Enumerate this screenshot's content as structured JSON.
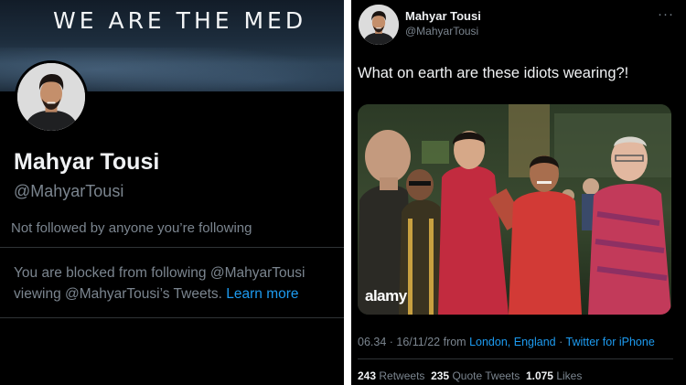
{
  "profile": {
    "banner_text": "WE ARE THE MED",
    "name": "Mahyar Tousi",
    "handle": "@MahyarTousi",
    "follow_context": "Not followed by anyone you’re following",
    "blocked_text": "You are blocked from following @MahyarTousi viewing @MahyarTousi’s Tweets.",
    "learn_more": "Learn more"
  },
  "tweet": {
    "author_name": "Mahyar Tousi",
    "author_handle": "@MahyarTousi",
    "more_label": "···",
    "text": "What on earth are these idiots wearing?!",
    "image_watermark": "alamy",
    "time_date": "06.34 · 16/11/22 from",
    "location": "London, England",
    "separator": "·",
    "source": "Twitter for iPhone",
    "retweets_count": "243",
    "retweets_label": "Retweets",
    "quotes_count": "235",
    "quotes_label": "Quote Tweets",
    "likes_count": "1.075",
    "likes_label": "Likes"
  },
  "colors": {
    "background": "#000000",
    "text_primary": "#e7e9ea",
    "text_secondary": "#7b858f",
    "link": "#1d9bf0",
    "separator": "#ffffff"
  }
}
